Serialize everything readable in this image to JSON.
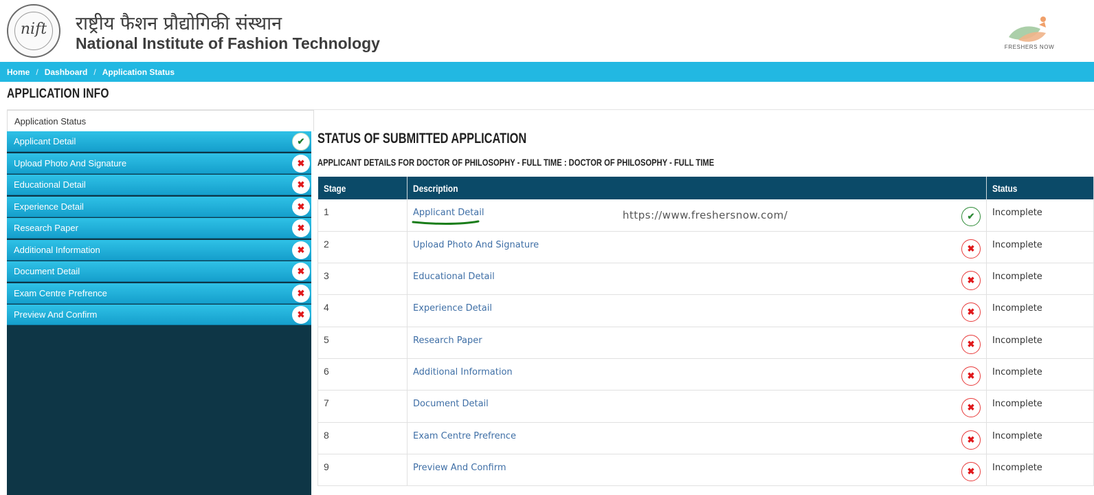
{
  "header": {
    "logo_mark": "nift",
    "hindi_title": "राष्ट्रीय फैशन प्रौद्योगिकी संस्थान",
    "english_title": "National Institute of Fashion Technology",
    "brand_text": "FRESHERS NOW"
  },
  "breadcrumb": {
    "items": [
      "Home",
      "Dashboard",
      "Application Status"
    ],
    "separator": "/"
  },
  "page_title": "APPLICATION INFO",
  "sidebar": {
    "tab_label": "Application Status",
    "items": [
      {
        "label": "Applicant Detail",
        "status": "complete",
        "icon": "check-icon"
      },
      {
        "label": "Upload Photo And Signature",
        "status": "incomplete",
        "icon": "cross-icon"
      },
      {
        "label": "Educational Detail",
        "status": "incomplete",
        "icon": "cross-icon"
      },
      {
        "label": "Experience Detail",
        "status": "incomplete",
        "icon": "cross-icon"
      },
      {
        "label": "Research Paper",
        "status": "incomplete",
        "icon": "cross-icon"
      },
      {
        "label": "Additional Information",
        "status": "incomplete",
        "icon": "cross-icon"
      },
      {
        "label": "Document Detail",
        "status": "incomplete",
        "icon": "cross-icon"
      },
      {
        "label": "Exam Centre Prefrence",
        "status": "incomplete",
        "icon": "cross-icon"
      },
      {
        "label": "Preview And Confirm",
        "status": "incomplete",
        "icon": "cross-icon"
      }
    ]
  },
  "main": {
    "heading": "STATUS OF SUBMITTED APPLICATION",
    "subheading": "APPLICANT DETAILS FOR DOCTOR OF PHILOSOPHY - FULL TIME : DOCTOR OF PHILOSOPHY - FULL TIME",
    "table": {
      "columns": [
        "Stage",
        "Description",
        "Status"
      ],
      "rows": [
        {
          "stage": "1",
          "description": "Applicant Detail",
          "status": "Incomplete",
          "icon": "ok"
        },
        {
          "stage": "2",
          "description": "Upload Photo And Signature",
          "status": "Incomplete",
          "icon": "bad"
        },
        {
          "stage": "3",
          "description": "Educational Detail",
          "status": "Incomplete",
          "icon": "bad"
        },
        {
          "stage": "4",
          "description": "Experience Detail",
          "status": "Incomplete",
          "icon": "bad"
        },
        {
          "stage": "5",
          "description": "Research Paper",
          "status": "Incomplete",
          "icon": "bad"
        },
        {
          "stage": "6",
          "description": "Additional Information",
          "status": "Incomplete",
          "icon": "bad"
        },
        {
          "stage": "7",
          "description": "Document Detail",
          "status": "Incomplete",
          "icon": "bad"
        },
        {
          "stage": "8",
          "description": "Exam Centre Prefrence",
          "status": "Incomplete",
          "icon": "bad"
        },
        {
          "stage": "9",
          "description": "Preview And Confirm",
          "status": "Incomplete",
          "icon": "bad"
        }
      ]
    },
    "watermark": "https://www.freshersnow.com/"
  },
  "colors": {
    "breadcrumb_bg": "#22b8e2",
    "sidebar_dark": "#0e3646",
    "table_header": "#0b4a68",
    "link": "#3f6fa6",
    "ok": "#2e8b37",
    "bad": "#e0181b"
  }
}
